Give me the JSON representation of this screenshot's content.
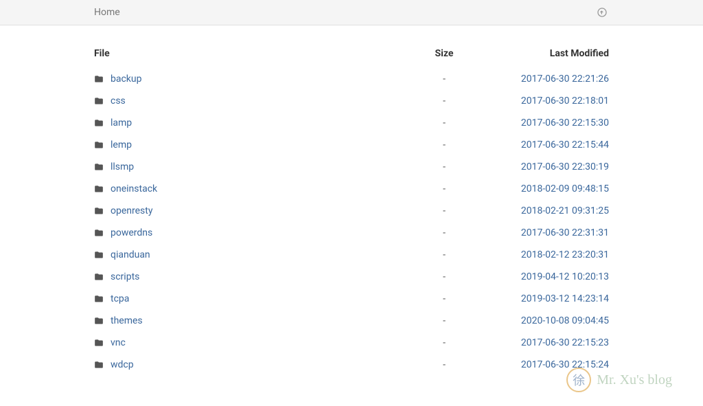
{
  "breadcrumb": {
    "home": "Home"
  },
  "columns": {
    "file": "File",
    "size": "Size",
    "date": "Last Modified"
  },
  "files": [
    {
      "name": "backup",
      "size": "-",
      "modified": "2017-06-30 22:21:26"
    },
    {
      "name": "css",
      "size": "-",
      "modified": "2017-06-30 22:18:01"
    },
    {
      "name": "lamp",
      "size": "-",
      "modified": "2017-06-30 22:15:30"
    },
    {
      "name": "lemp",
      "size": "-",
      "modified": "2017-06-30 22:15:44"
    },
    {
      "name": "llsmp",
      "size": "-",
      "modified": "2017-06-30 22:30:19"
    },
    {
      "name": "oneinstack",
      "size": "-",
      "modified": "2018-02-09 09:48:15"
    },
    {
      "name": "openresty",
      "size": "-",
      "modified": "2018-02-21 09:31:25"
    },
    {
      "name": "powerdns",
      "size": "-",
      "modified": "2017-06-30 22:31:31"
    },
    {
      "name": "qianduan",
      "size": "-",
      "modified": "2018-02-12 23:20:31"
    },
    {
      "name": "scripts",
      "size": "-",
      "modified": "2019-04-12 10:20:13"
    },
    {
      "name": "tcpa",
      "size": "-",
      "modified": "2019-03-12 14:23:14"
    },
    {
      "name": "themes",
      "size": "-",
      "modified": "2020-10-08 09:04:45"
    },
    {
      "name": "vnc",
      "size": "-",
      "modified": "2017-06-30 22:15:23"
    },
    {
      "name": "wdcp",
      "size": "-",
      "modified": "2017-06-30 22:15:24"
    }
  ],
  "watermark": {
    "char": "徐",
    "text": "Mr. Xu's blog"
  }
}
